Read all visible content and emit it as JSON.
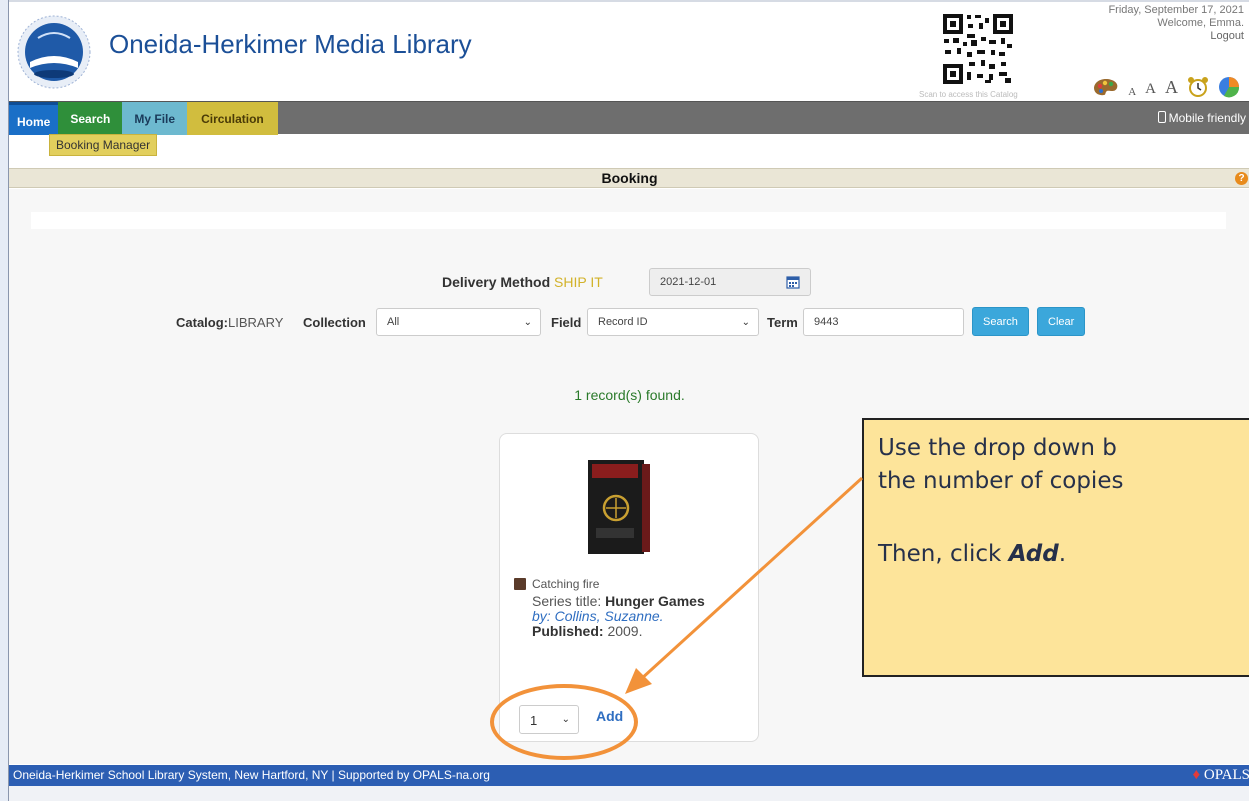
{
  "header": {
    "site_title": "Oneida-Herkimer Media Library",
    "qr_caption": "Scan to access this Catalog",
    "date": "Friday, September 17, 2021",
    "welcome": "Welcome, Emma.",
    "logout": "Logout",
    "font_small": "A",
    "font_medium": "A",
    "font_large": "A"
  },
  "nav": {
    "tabs": [
      "Home",
      "Search",
      "My File",
      "Circulation"
    ],
    "mobile": "Mobile friendly",
    "subnav": "Booking Manager"
  },
  "booking": {
    "title": "Booking",
    "delivery_label": "Delivery Method",
    "delivery_value": "SHIP IT",
    "date_value": "2021-12-01",
    "catalog_label": "Catalog:",
    "catalog_value": "LIBRARY",
    "collection_label": "Collection",
    "collection_value": "All",
    "field_label": "Field",
    "field_value": "Record ID",
    "term_label": "Term",
    "term_value": "9443",
    "search_button": "Search",
    "clear_button": "Clear",
    "found": "1 record(s) found."
  },
  "record": {
    "title": "Catching fire",
    "series_label": "Series title:",
    "series_value": "Hunger Games",
    "by_label": "by:",
    "author": "Collins, Suzanne.",
    "published_label": "Published:",
    "published_value": "2009.",
    "qty": "1",
    "add": "Add"
  },
  "footer": {
    "text": "Oneida-Herkimer School Library System, New Hartford, NY | Supported by OPALS-na.org",
    "brand": "OPALS"
  },
  "callout": {
    "line1": "Use the drop down b",
    "line2": "the number of copies",
    "then": "Then, click ",
    "add": "Add",
    "period": "."
  },
  "colors": {
    "title_blue": "#1b4f97",
    "callout_bg": "#fde49a",
    "highlight_orange": "#f2923a",
    "footer_blue": "#2c5eb3"
  }
}
